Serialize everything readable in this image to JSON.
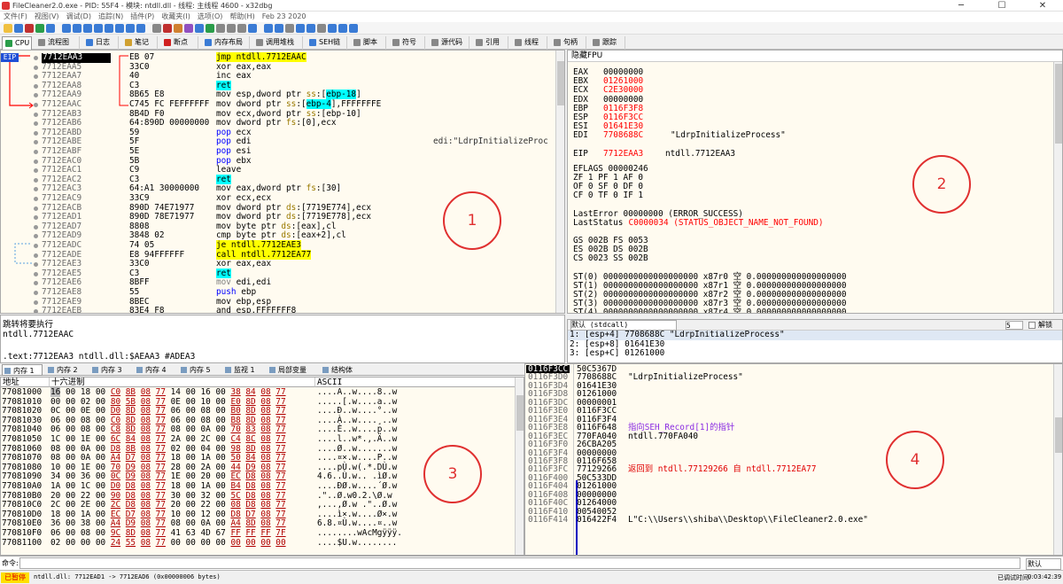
{
  "window": {
    "title": "FileCleaner2.0.exe - PID: 55F4 - 模块: ntdll.dll - 线程: 主线程 4600 - x32dbg",
    "menu": [
      "文件(F)",
      "视图(V)",
      "调试(D)",
      "追踪(N)",
      "插件(P)",
      "收藏夹(I)",
      "选项(O)",
      "帮助(H)",
      "Feb 23 2020"
    ]
  },
  "tabs": [
    "CPU",
    "流程图",
    "日志",
    "笔记",
    "断点",
    "内存布局",
    "调用堆栈",
    "SEH链",
    "脚本",
    "符号",
    "源代码",
    "引用",
    "线程",
    "句柄",
    "跟踪"
  ],
  "cpu": {
    "eip_label": "EIP",
    "rows": [
      {
        "addr": "7712EAA3",
        "bytes": "EB 07",
        "dis": "jmp ntdll.7712EAAC",
        "cmt": "",
        "kind": "jmp"
      },
      {
        "addr": "7712EAA5",
        "bytes": "33C0",
        "dis": "xor eax,eax",
        "cmt": "",
        "kind": "mov"
      },
      {
        "addr": "7712EAA7",
        "bytes": "40",
        "dis": "inc eax",
        "cmt": "",
        "kind": "mov"
      },
      {
        "addr": "7712EAA8",
        "bytes": "C3",
        "dis": "ret",
        "cmt": "",
        "kind": "ret"
      },
      {
        "addr": "7712EAA9",
        "bytes": "8B65 E8",
        "dis": "mov esp,dword ptr ss:[ebp-18]",
        "cmt": "",
        "kind": "mov"
      },
      {
        "addr": "7712EAAC",
        "bytes": "C745 FC FEFFFFFF",
        "dis": "mov dword ptr ss:[ebp-4],FFFFFFFE",
        "cmt": "",
        "kind": "mov"
      },
      {
        "addr": "7712EAB3",
        "bytes": "8B4D F0",
        "dis": "mov ecx,dword ptr ss:[ebp-10]",
        "cmt": "",
        "kind": "mov"
      },
      {
        "addr": "7712EAB6",
        "bytes": "64:890D 00000000",
        "dis": "mov dword ptr fs:[0],ecx",
        "cmt": "",
        "kind": "mov"
      },
      {
        "addr": "7712EABD",
        "bytes": "59",
        "dis": "pop ecx",
        "cmt": "",
        "kind": "push"
      },
      {
        "addr": "7712EABE",
        "bytes": "5F",
        "dis": "pop edi",
        "cmt": "edi:\"LdrpInitializeProc",
        "kind": "push"
      },
      {
        "addr": "7712EABF",
        "bytes": "5E",
        "dis": "pop esi",
        "cmt": "",
        "kind": "push"
      },
      {
        "addr": "7712EAC0",
        "bytes": "5B",
        "dis": "pop ebx",
        "cmt": "",
        "kind": "push"
      },
      {
        "addr": "7712EAC1",
        "bytes": "C9",
        "dis": "leave",
        "cmt": "",
        "kind": "mov"
      },
      {
        "addr": "7712EAC2",
        "bytes": "C3",
        "dis": "ret",
        "cmt": "",
        "kind": "ret"
      },
      {
        "addr": "7712EAC3",
        "bytes": "64:A1 30000000",
        "dis": "mov eax,dword ptr fs:[30]",
        "cmt": "",
        "kind": "mov"
      },
      {
        "addr": "7712EAC9",
        "bytes": "33C9",
        "dis": "xor ecx,ecx",
        "cmt": "",
        "kind": "mov"
      },
      {
        "addr": "7712EACB",
        "bytes": "890D 74E71977",
        "dis": "mov dword ptr ds:[7719E774],ecx",
        "cmt": "",
        "kind": "mov"
      },
      {
        "addr": "7712EAD1",
        "bytes": "890D 78E71977",
        "dis": "mov dword ptr ds:[7719E778],ecx",
        "cmt": "",
        "kind": "mov"
      },
      {
        "addr": "7712EAD7",
        "bytes": "8808",
        "dis": "mov byte ptr ds:[eax],cl",
        "cmt": "",
        "kind": "mov"
      },
      {
        "addr": "7712EAD9",
        "bytes": "3848 02",
        "dis": "cmp byte ptr ds:[eax+2],cl",
        "cmt": "",
        "kind": "mov"
      },
      {
        "addr": "7712EADC",
        "bytes": "74 05",
        "dis": "je ntdll.7712EAE3",
        "cmt": "",
        "kind": "jmp"
      },
      {
        "addr": "7712EADE",
        "bytes": "E8 94FFFFFF",
        "dis": "call ntdll.7712EA77",
        "cmt": "",
        "kind": "call"
      },
      {
        "addr": "7712EAE3",
        "bytes": "33C0",
        "dis": "xor eax,eax",
        "cmt": "",
        "kind": "mov"
      },
      {
        "addr": "7712EAE5",
        "bytes": "C3",
        "dis": "ret",
        "cmt": "",
        "kind": "ret"
      },
      {
        "addr": "7712EAE6",
        "bytes": "8BFF",
        "dis": "mov edi,edi",
        "cmt": "",
        "kind": "gray"
      },
      {
        "addr": "7712EAE8",
        "bytes": "55",
        "dis": "push ebp",
        "cmt": "",
        "kind": "push"
      },
      {
        "addr": "7712EAE9",
        "bytes": "8BEC",
        "dis": "mov ebp,esp",
        "cmt": "",
        "kind": "mov"
      },
      {
        "addr": "7712EAEB",
        "bytes": "83E4 F8",
        "dis": "and esp,FFFFFFF8",
        "cmt": "",
        "kind": "mov"
      }
    ]
  },
  "hint": {
    "line1": "跳转将要执行",
    "line2": "ntdll.7712EAAC",
    "line3": ".text:7712EAA3 ntdll.dll:$AEAA3 #ADEA3"
  },
  "registers": {
    "header": "隐藏FPU",
    "lines": [
      {
        "name": "EAX",
        "val": "00000000",
        "extra": "",
        "red": false
      },
      {
        "name": "EBX",
        "val": "01261000",
        "extra": "",
        "red": true
      },
      {
        "name": "ECX",
        "val": "C2E30000",
        "extra": "",
        "red": true
      },
      {
        "name": "EDX",
        "val": "00000000",
        "extra": "",
        "red": false
      },
      {
        "name": "EBP",
        "val": "0116F3F8",
        "extra": "",
        "red": true
      },
      {
        "name": "ESP",
        "val": "0116F3CC",
        "extra": "",
        "red": true
      },
      {
        "name": "ESI",
        "val": "01641E30",
        "extra": "",
        "red": true
      },
      {
        "name": "EDI",
        "val": "7708688C",
        "extra": "\"LdrpInitializeProcess\"",
        "red": true
      },
      {
        "name": "",
        "val": "",
        "extra": "",
        "red": false
      },
      {
        "name": "EIP",
        "val": "7712EAA3",
        "extra": "ntdll.7712EAA3",
        "red": true
      }
    ],
    "eflags": "EFLAGS   00000246",
    "flags1": "ZF 1  PF 1  AF 0",
    "flags2": "OF 0  SF 0  DF 0",
    "flags3": "CF 0  TF 0  IF 1",
    "lasterror": "LastError  00000000 (ERROR_SUCCESS)",
    "laststatus_label": "LastStatus",
    "laststatus_val": "C0000034 (STATUS_OBJECT_NAME_NOT_FOUND)",
    "seg1": "GS 002B  FS 0053",
    "seg2": "ES 002B  DS 002B",
    "seg3": "CS 0023  SS 002B",
    "fpu": [
      "ST(0) 0000000000000000000 x87r0 空 0.000000000000000000",
      "ST(1) 0000000000000000000 x87r1 空 0.000000000000000000",
      "ST(2) 0000000000000000000 x87r2 空 0.000000000000000000",
      "ST(3) 0000000000000000000 x87r3 空 0.000000000000000000",
      "ST(4) 0000000000000000000 x87r4 空 0.000000000000000000"
    ]
  },
  "stackargs": {
    "header": "默认 (stdcall)",
    "count": "5",
    "lock_label": "解锁",
    "lines": [
      "1: [esp+4] 7708688C \"LdrpInitializeProcess\"",
      "2: [esp+8] 01641E30",
      "3: [esp+C] 01261000"
    ]
  },
  "dumptabs": [
    "内存 1",
    "内存 2",
    "内存 3",
    "内存 4",
    "内存 5",
    "监视 1",
    "局部变量",
    "结构体"
  ],
  "dump": {
    "headers": {
      "addr": "地址",
      "hex": "十六进制",
      "ascii": "ASCII"
    },
    "rows": [
      {
        "a": "77081000",
        "h": "16 00 18 00 C0 8B 08 77 14 00 16 00 38 84 08 77",
        "x": "....A..w....8..w"
      },
      {
        "a": "77081010",
        "h": "00 00 02 00 80 5B 08 77 0E 00 10 00 E0 8D 08 77",
        "x": ".....[.w....a..w"
      },
      {
        "a": "77081020",
        "h": "0C 00 0E 00 D0 8D 08 77 06 00 08 00 B0 8D 08 77",
        "x": "....Ð..w....°..w"
      },
      {
        "a": "77081030",
        "h": "06 00 08 00 C0 8D 08 77 06 00 08 00 B8 8D 08 77",
        "x": "....À..w....¸..w"
      },
      {
        "a": "77081040",
        "h": "06 00 08 00 C8 8D 08 77 08 00 0A 00 70 83 08 77",
        "x": "....È..w....p..w"
      },
      {
        "a": "77081050",
        "h": "1C 00 1E 00 6C 84 08 77 2A 00 2C 00 C4 8C 08 77",
        "x": "....l..w*.,.Ä..w"
      },
      {
        "a": "77081060",
        "h": "08 00 0A 00 D8 8B 08 77 02 00 04 00 98 8D 08 77",
        "x": "....Ø..w.......w"
      },
      {
        "a": "77081070",
        "h": "08 00 0A 00 A4 D7 08 77 18 00 1A 00 50 84 08 77",
        "x": "....¤×.w....P..w"
      },
      {
        "a": "77081080",
        "h": "10 00 1E 00 70 D9 08 77 28 00 2A 00 44 D9 08 77",
        "x": "....pÙ.w(.*.DÙ.w"
      },
      {
        "a": "77081090",
        "h": "34 00 36 00 0C D9 08 77 1E 00 20 00 EC D8 08 77",
        "x": "4.6..Ù.w.. .ìØ.w"
      },
      {
        "a": "770810A0",
        "h": "1A 00 1C 00 D0 D8 08 77 18 00 1A 00 B4 D8 08 77",
        "x": "....ÐØ.w....´Ø.w"
      },
      {
        "a": "770810B0",
        "h": "20 00 22 00 90 D8 08 77 30 00 32 00 5C D8 08 77",
        "x": " .\"..Ø.w0.2.\\Ø.w"
      },
      {
        "a": "770810C0",
        "h": "2C 00 2E 00 2C D8 08 77 20 00 22 00 08 D8 08 77",
        "x": ",...,Ø.w .\"..Ø.w"
      },
      {
        "a": "770810D0",
        "h": "18 00 1A 00 EC D7 08 77 10 00 12 00 D8 D7 08 77",
        "x": "....ì×.w....Ø×.w"
      },
      {
        "a": "770810E0",
        "h": "36 00 38 00 A4 D9 08 77 08 00 0A 00 A4 8D 08 77",
        "x": "6.8.¤Ù.w....¤..w"
      },
      {
        "a": "770810F0",
        "h": "06 00 08 00 9C 8D 08 77 41 63 4D 67 FF FF FF 7F",
        "x": "........wAcMgÿÿÿ."
      },
      {
        "a": "77081100",
        "h": "02 00 00 00 24 55 08 77 00 00 00 00 00 00 00 00",
        "x": "....$U.w........"
      }
    ]
  },
  "stack": {
    "rows": [
      {
        "a": "0116F3CC",
        "v": "50C5367D",
        "c": "",
        "style": "",
        "cur": true
      },
      {
        "a": "0116F3D0",
        "v": "7708688C",
        "c": "\"LdrpInitializeProcess\"",
        "style": "",
        "cur": false
      },
      {
        "a": "0116F3D4",
        "v": "01641E30",
        "c": "",
        "style": "",
        "cur": false
      },
      {
        "a": "0116F3D8",
        "v": "01261000",
        "c": "",
        "style": "",
        "cur": false
      },
      {
        "a": "0116F3DC",
        "v": "00000001",
        "c": "",
        "style": "",
        "cur": false
      },
      {
        "a": "0116F3E0",
        "v": "0116F3CC",
        "c": "",
        "style": "",
        "cur": false
      },
      {
        "a": "0116F3E4",
        "v": "0116F3F4",
        "c": "",
        "style": "",
        "cur": false
      },
      {
        "a": "0116F3E8",
        "v": "0116F648",
        "c": "指向SEH_Record[1]的指针",
        "style": "purple",
        "cur": false
      },
      {
        "a": "0116F3EC",
        "v": "770FA040",
        "c": "ntdll.770FA040",
        "style": "",
        "cur": false
      },
      {
        "a": "0116F3F0",
        "v": "26CBA205",
        "c": "",
        "style": "",
        "cur": false
      },
      {
        "a": "0116F3F4",
        "v": "00000000",
        "c": "",
        "style": "",
        "cur": false
      },
      {
        "a": "0116F3F8",
        "v": "0116F658",
        "c": "",
        "style": "",
        "cur": false
      },
      {
        "a": "0116F3FC",
        "v": "77129266",
        "c": "返回到 ntdll.77129266 自 ntdll.7712EA77",
        "style": "redtxt",
        "cur": false
      },
      {
        "a": "0116F400",
        "v": "50C533DD",
        "c": "",
        "style": "",
        "cur": false
      },
      {
        "a": "0116F404",
        "v": "01261000",
        "c": "",
        "style": "",
        "cur": false
      },
      {
        "a": "0116F408",
        "v": "00000000",
        "c": "",
        "style": "",
        "cur": false
      },
      {
        "a": "0116F40C",
        "v": "01264000",
        "c": "",
        "style": "",
        "cur": false
      },
      {
        "a": "0116F410",
        "v": "00540052",
        "c": "",
        "style": "",
        "cur": false
      },
      {
        "a": "0116F414",
        "v": "016422F4",
        "c": "L\"C:\\\\Users\\\\shiba\\\\Desktop\\\\FileCleaner2.0.exe\"",
        "style": "",
        "cur": false
      }
    ]
  },
  "command": {
    "label": "命令:",
    "value": "",
    "default_label": "默认"
  },
  "status": {
    "paused": "已暂停",
    "text": "ntdll.dll: 7712EAD1 -> 7712EAD6 (0x00000006 bytes)",
    "attached": "已调试时间:",
    "time": "0:03:42:39"
  },
  "annotations": [
    "1",
    "2",
    "3",
    "4"
  ]
}
